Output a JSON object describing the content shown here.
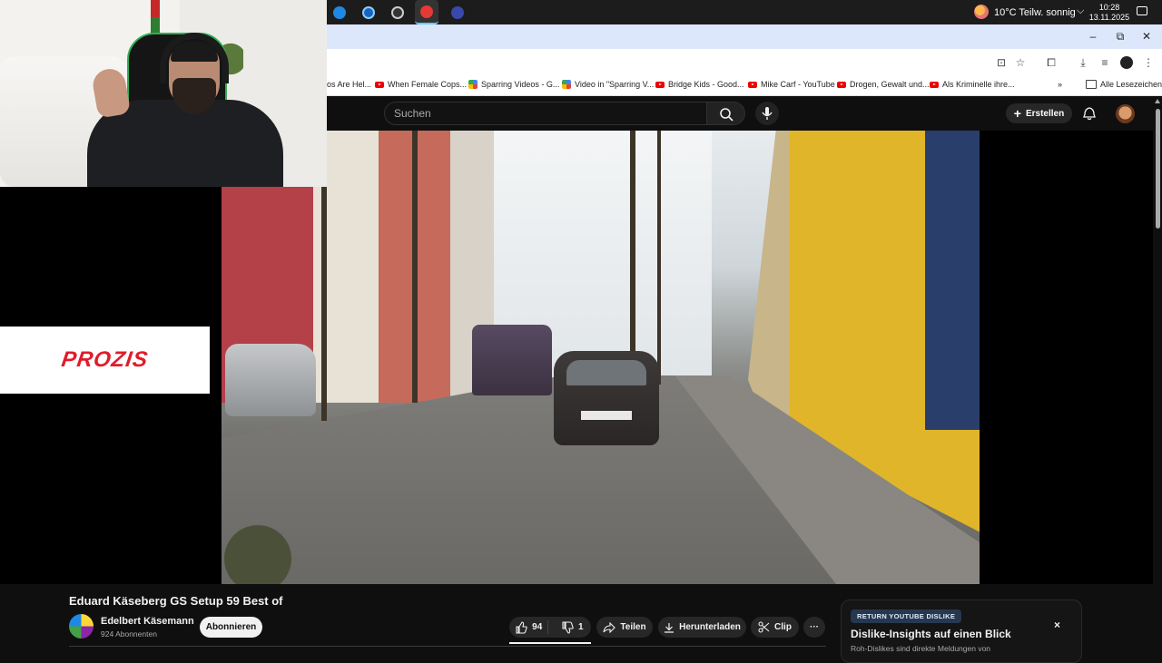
{
  "taskbar": {
    "weather": "10°C  Teilw. sonnig",
    "time": "10:28",
    "date": "13.11.2025",
    "apps": [
      "edge-app",
      "ccleaner-app",
      "speedometer-app",
      "youtube-app",
      "taskmanager-app"
    ]
  },
  "bookmarks": {
    "items": [
      {
        "label": "os Are Hel...",
        "icon": "none"
      },
      {
        "label": "When Female Cops...",
        "icon": "youtube"
      },
      {
        "label": "Sparring Videos - G...",
        "icon": "pinwheel"
      },
      {
        "label": "Video in \"Sparring V...",
        "icon": "pinwheel"
      },
      {
        "label": "Bridge Kids - Good...",
        "icon": "youtube"
      },
      {
        "label": "Mike Carf - YouTube",
        "icon": "youtube"
      },
      {
        "label": "Drogen, Gewalt und...",
        "icon": "youtube"
      },
      {
        "label": "Als Kriminelle ihre...",
        "icon": "youtube"
      }
    ],
    "overflow": "»",
    "all_bookmarks": "Alle Lesezeichen"
  },
  "youtube": {
    "search_placeholder": "Suchen",
    "create_label": "Erstellen"
  },
  "ad": {
    "logo_text": "PROZIS"
  },
  "video": {
    "title": "Eduard Käseberg GS Setup 59 Best of",
    "channel": "Edelbert Käsemann",
    "subscribers": "924 Abonnenten",
    "subscribe_label": "Abonnieren",
    "likes": "94",
    "dislikes": "1",
    "share_label": "Teilen",
    "download_label": "Herunterladen",
    "clip_label": "Clip",
    "more_label": "···"
  },
  "ryd": {
    "badge": "RETURN YOUTUBE DISLIKE",
    "title": "Dislike-Insights auf einen Blick",
    "description": "Roh-Dislikes sind direkte Meldungen von",
    "close": "×"
  },
  "colors": {
    "accent_red": "#e21b2a",
    "youtube_bg": "#0f0f0f",
    "chrome_titlebar": "#dde7fb"
  }
}
